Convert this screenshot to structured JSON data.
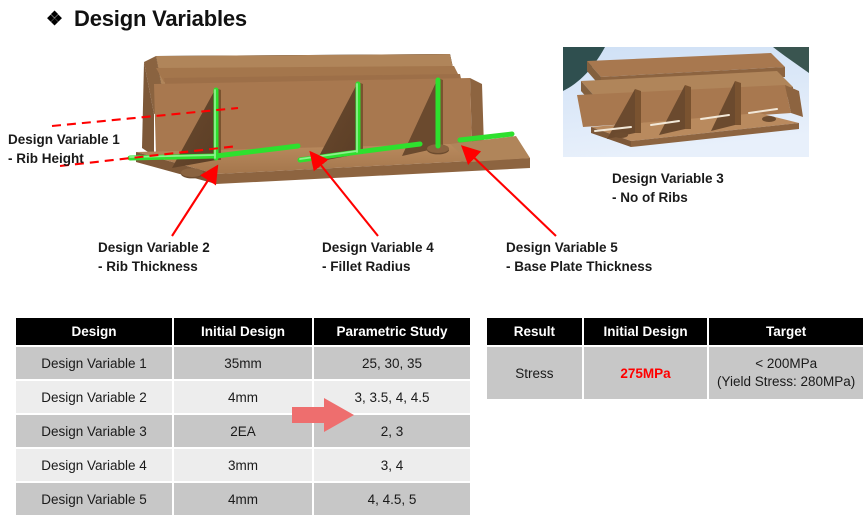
{
  "slide": {
    "title": "Design Variables",
    "bullet_glyph": "❖"
  },
  "figures": {
    "main": {
      "name": "bracket-cad-model",
      "description": "Isometric CAD view of a welded bracket: base plate with mounting holes and triangular stiffener ribs, green highlighted weld/edge lines",
      "body_color": "#a8784f",
      "highlight_color": "#2ee02e"
    },
    "ribs": {
      "name": "three-rib-cad-model",
      "description": "Isometric CAD view of base plate with three triangular ribs on a blue gradient background",
      "body_color": "#a8784f",
      "bg_top": "#2f4f4f",
      "bg_bottom": "#cfe0f5"
    }
  },
  "callouts": [
    {
      "id": "dv1",
      "line1": "Design Variable 1",
      "line2": "- Rib Height"
    },
    {
      "id": "dv2",
      "line1": "Design Variable 2",
      "line2": "- Rib Thickness"
    },
    {
      "id": "dv3",
      "line1": "Design Variable 3",
      "line2": "- No of Ribs"
    },
    {
      "id": "dv4",
      "line1": "Design Variable 4",
      "line2": "- Fillet Radius"
    },
    {
      "id": "dv5",
      "line1": "Design Variable 5",
      "line2": "- Base Plate Thickness"
    }
  ],
  "design_table": {
    "headers": [
      "Design",
      "Initial Design",
      "Parametric Study"
    ],
    "rows": [
      {
        "design": "Design Variable 1",
        "initial": "35mm",
        "parametric": "25, 30, 35"
      },
      {
        "design": "Design Variable 2",
        "initial": "4mm",
        "parametric": "3, 3.5, 4, 4.5"
      },
      {
        "design": "Design Variable 3",
        "initial": "2EA",
        "parametric": "2, 3"
      },
      {
        "design": "Design Variable 4",
        "initial": "3mm",
        "parametric": "3, 4"
      },
      {
        "design": "Design Variable 5",
        "initial": "4mm",
        "parametric": "4, 4.5, 5"
      }
    ]
  },
  "result_table": {
    "headers": [
      "Result",
      "Initial Design",
      "Target"
    ],
    "row": {
      "result": "Stress",
      "initial": "275MPa",
      "target_line1": "< 200MPa",
      "target_line2": "(Yield Stress: 280MPa)"
    }
  },
  "colors": {
    "header_bg": "#000000",
    "row_dark": "#c7c7c7",
    "row_light": "#ededed",
    "warning_text": "#ff0000",
    "arrow_red": "#ff0000",
    "arrow_pink": "#ee6e6e",
    "highlight_green": "#2ee02e"
  }
}
